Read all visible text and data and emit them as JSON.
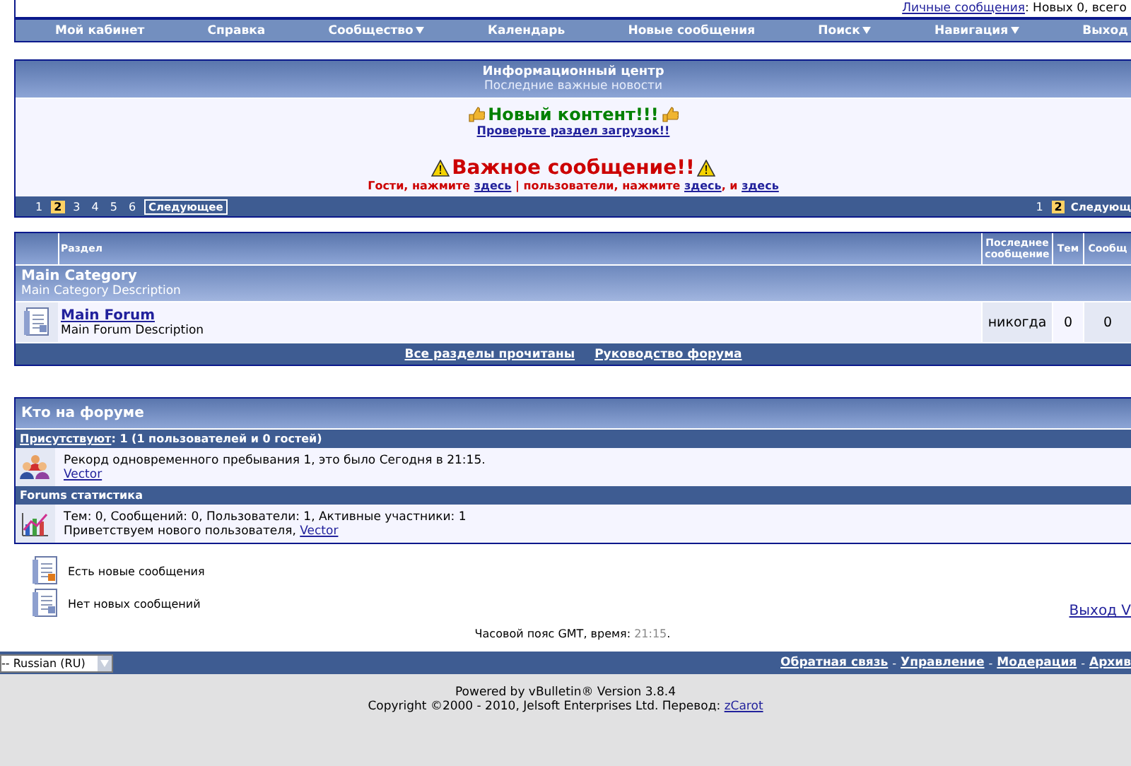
{
  "top_bar": {
    "pm_link": "Личные сообщения",
    "pm_text": ": Новых 0, всего"
  },
  "nav": [
    {
      "label": "Мой кабинет",
      "dropdown": false
    },
    {
      "label": "Справка",
      "dropdown": false
    },
    {
      "label": "Сообщество",
      "dropdown": true
    },
    {
      "label": "Календарь",
      "dropdown": false
    },
    {
      "label": "Новые сообщения",
      "dropdown": false
    },
    {
      "label": "Поиск",
      "dropdown": true
    },
    {
      "label": "Навигация",
      "dropdown": true
    },
    {
      "label": "Выход",
      "dropdown": false
    }
  ],
  "notice": {
    "title": "Информационный центр",
    "subtitle": "Последние важные новости",
    "headline": "Новый контент!!!",
    "headline_link": "Проверьте раздел загрузок!!",
    "alert": "Важное сообщение!!",
    "alert_parts": [
      {
        "kind": "text",
        "text": "Гости, нажмите "
      },
      {
        "kind": "link",
        "text": "здесь"
      },
      {
        "kind": "text",
        "text": " | пользователи, нажмите "
      },
      {
        "kind": "link",
        "text": "здесь"
      },
      {
        "kind": "text",
        "text": ", и "
      },
      {
        "kind": "link",
        "text": "здесь"
      }
    ],
    "pages_left": [
      {
        "label": "1",
        "selected": false
      },
      {
        "label": "2",
        "selected": true
      },
      {
        "label": "3",
        "selected": false
      },
      {
        "label": "4",
        "selected": false
      },
      {
        "label": "5",
        "selected": false
      },
      {
        "label": "6",
        "selected": false
      }
    ],
    "next_left": "Следующее",
    "pages_right": [
      {
        "label": "1",
        "selected": false
      },
      {
        "label": "2",
        "selected": true
      }
    ],
    "next_right": "Следующ"
  },
  "forum_table": {
    "columns": [
      "Раздел",
      "Последнее сообщение",
      "Тем",
      "Сообщ"
    ],
    "category": {
      "title": "Main Category",
      "description": "Main Category Description"
    },
    "forums": [
      {
        "title": "Main Forum",
        "description": "Main Forum Description",
        "last_post": "никогда",
        "threads": "0",
        "posts": "0"
      }
    ],
    "footer_links": [
      "Все разделы прочитаны",
      "Руководство форума"
    ]
  },
  "whos_online": {
    "title": "Кто на форуме",
    "present_link": "Присутствуют",
    "present_text": ": 1 (1 пользователей и 0 гостей)",
    "record": "Рекорд одновременного пребывания 1, это было Сегодня в 21:15.",
    "user": "Vector",
    "stats_title": "Forums статистика",
    "stats_line": "Тем: 0, Сообщений: 0, Пользователи: 1, Активные участники: 1",
    "welcome": "Приветствуем нового пользователя, ",
    "new_user": "Vector"
  },
  "legend": [
    {
      "label": "Есть новые сообщения",
      "kind": "new"
    },
    {
      "label": "Нет новых сообщений",
      "kind": "old"
    }
  ],
  "logout": "Выход V",
  "timezone": {
    "text": "Часовой пояс GMT, время: ",
    "time": "21:15",
    "end": "."
  },
  "footer": {
    "language": "-- Russian (RU)",
    "links": [
      "Обратная связь",
      "Управление",
      "Модерация",
      "Архив"
    ],
    "separator": "-",
    "powered": "Powered by vBulletin® Version 3.8.4",
    "copyright": "Copyright ©2000 - 2010, Jelsoft Enterprises Ltd. Перевод: ",
    "translator": "zCarot"
  }
}
